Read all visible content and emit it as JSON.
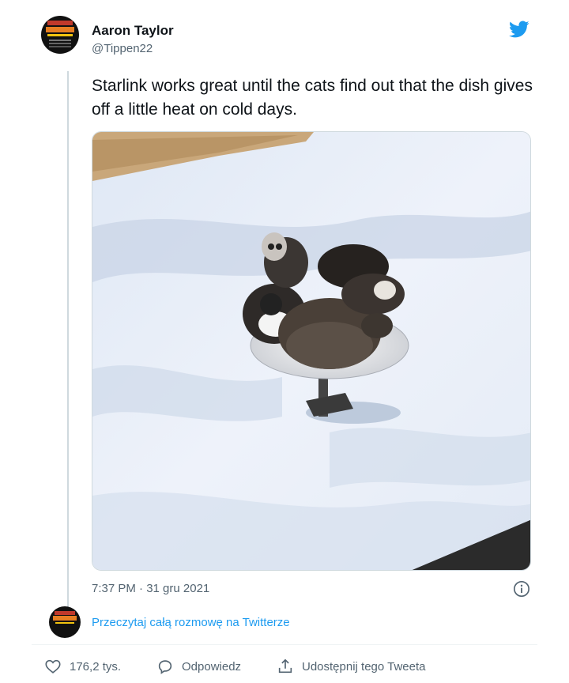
{
  "author": {
    "name": "Aaron Taylor",
    "handle": "@Tippen22"
  },
  "tweet": {
    "text": "Starlink works great until the cats find out that the dish gives off a little heat on cold days."
  },
  "timestamp": "7:37 PM · 31 gru 2021",
  "thread": {
    "read_link": "Przeczytaj całą rozmowę na Twitterze"
  },
  "actions": {
    "likes": "176,2 tys.",
    "reply": "Odpowiedz",
    "share": "Udostępnij tego Tweeta"
  },
  "icons": {
    "brand": "twitter-bird-icon",
    "info": "info-icon",
    "like": "heart-icon",
    "reply": "speech-bubble-icon",
    "share": "share-icon"
  },
  "colors": {
    "accent": "#1d9bf0",
    "text": "#0f1419",
    "secondary": "#536471"
  }
}
